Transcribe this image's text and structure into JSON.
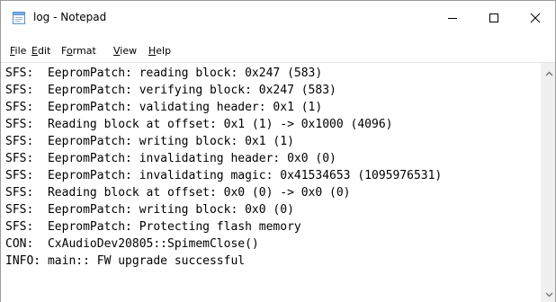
{
  "window": {
    "title": "log - Notepad"
  },
  "icons": {
    "app": "notepad-icon",
    "minimize": "minimize-icon",
    "maximize": "maximize-icon",
    "close": "close-icon",
    "scroll_up": "chevron-up-icon",
    "scroll_down": "chevron-down-icon"
  },
  "menu": {
    "items": [
      {
        "accel": "F",
        "rest": "ile"
      },
      {
        "accel": "E",
        "rest": "dit"
      },
      {
        "pre": "F",
        "accel": "o",
        "rest": "rmat"
      },
      {
        "accel": "V",
        "rest": "iew"
      },
      {
        "accel": "H",
        "rest": "elp"
      }
    ]
  },
  "editor": {
    "lines": [
      "SFS:  EepromPatch: reading block: 0x247 (583)",
      "SFS:  EepromPatch: verifying block: 0x247 (583)",
      "SFS:  EepromPatch: validating header: 0x1 (1)",
      "SFS:  Reading block at offset: 0x1 (1) -> 0x1000 (4096)",
      "SFS:  EepromPatch: writing block: 0x1 (1)",
      "SFS:  EepromPatch: invalidating header: 0x0 (0)",
      "SFS:  EepromPatch: invalidating magic: 0x41534653 (1095976531)",
      "SFS:  Reading block at offset: 0x0 (0) -> 0x0 (0)",
      "SFS:  EepromPatch: writing block: 0x0 (0)",
      "SFS:  EepromPatch: Protecting flash memory",
      "CON:  CxAudioDev20805::SpimemClose()",
      "INFO: main:: FW upgrade successful"
    ]
  }
}
